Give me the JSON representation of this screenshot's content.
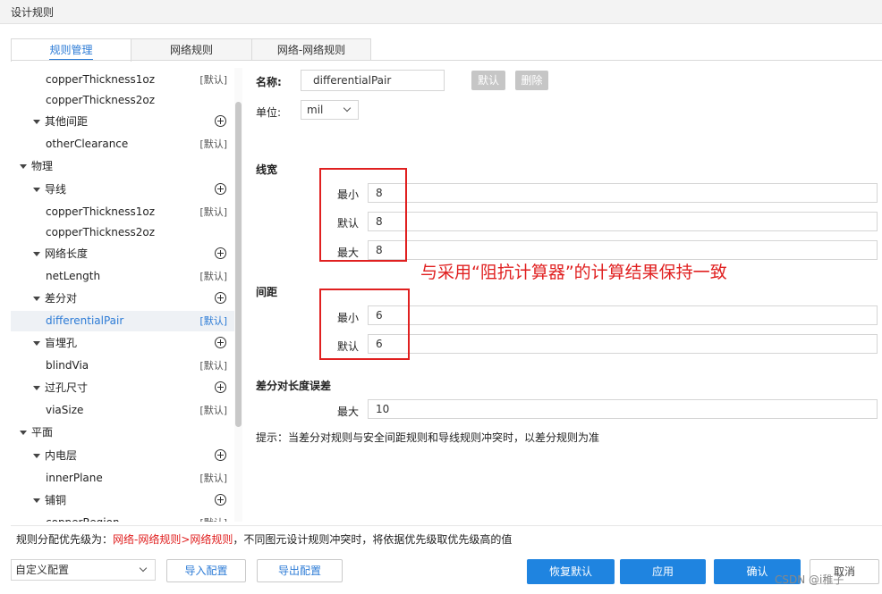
{
  "window": {
    "title": "设计规则"
  },
  "tabs": [
    {
      "label": "规则管理",
      "active": true
    },
    {
      "label": "网络规则",
      "active": false
    },
    {
      "label": "网络-网络规则",
      "active": false
    }
  ],
  "tree": [
    {
      "label": "copperThickness1oz",
      "badge": "[默认]"
    },
    {
      "label": "copperThickness2oz",
      "badge": ""
    },
    {
      "label": "其他间距",
      "group": true
    },
    {
      "label": "otherClearance",
      "badge": "[默认]"
    },
    {
      "label": "物理",
      "group": true
    },
    {
      "label": "导线",
      "group": true
    },
    {
      "label": "copperThickness1oz",
      "badge": "[默认]"
    },
    {
      "label": "copperThickness2oz",
      "badge": ""
    },
    {
      "label": "网络长度",
      "group": true
    },
    {
      "label": "netLength",
      "badge": "[默认]"
    },
    {
      "label": "差分对",
      "group": true
    },
    {
      "label": "differentialPair",
      "badge": "[默认]",
      "selected": true
    },
    {
      "label": "盲埋孔",
      "group": true
    },
    {
      "label": "blindVia",
      "badge": "[默认]"
    },
    {
      "label": "过孔尺寸",
      "group": true
    },
    {
      "label": "viaSize",
      "badge": "[默认]"
    },
    {
      "label": "平面",
      "group": true
    },
    {
      "label": "内电层",
      "group": true
    },
    {
      "label": "innerPlane",
      "badge": "[默认]"
    },
    {
      "label": "铺铜",
      "group": true
    },
    {
      "label": "copperRegion",
      "badge": "[默认]"
    }
  ],
  "form": {
    "name_label": "名称:",
    "name_value": "differentialPair",
    "default_btn": "默认",
    "delete_btn": "删除",
    "unit_label": "单位:",
    "unit_value": "mil",
    "width_section": "线宽",
    "width_min_label": "最小",
    "width_min": "8",
    "width_def_label": "默认",
    "width_def": "8",
    "width_max_label": "最大",
    "width_max": "8",
    "spacing_section": "间距",
    "spacing_min_label": "最小",
    "spacing_min": "6",
    "spacing_def_label": "默认",
    "spacing_def": "6",
    "len_section": "差分对长度误差",
    "len_max_label": "最大",
    "len_max": "10",
    "tip": "提示：当差分对规则与安全间距规则和导线规则冲突时，以差分规则为准"
  },
  "annotation": "与采用“阻抗计算器”的计算结果保持一致",
  "footer": {
    "priority_prefix": "规则分配优先级为：",
    "priority_red": "网络-网络规则>网络规则",
    "priority_suffix": "，不同图元设计规则冲突时，将依据优先级取优先级高的值",
    "config_value": "自定义配置",
    "import_btn": "导入配置",
    "export_btn": "导出配置",
    "restore_btn": "恢复默认",
    "apply_btn": "应用",
    "ok_btn": "确认",
    "cancel_btn": "取消"
  },
  "watermark": "CSDN @i稚子",
  "colors": {
    "accent": "#1f84e0",
    "annotation": "#e02020",
    "disabled_button": "#c6c6c6"
  }
}
